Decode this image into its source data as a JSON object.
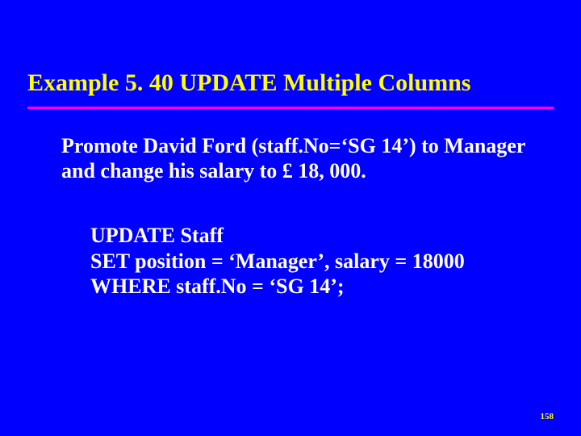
{
  "slide": {
    "title": "Example 5. 40  UPDATE Multiple Columns",
    "description_line1": "Promote David Ford (staff.No=‘SG 14’) to Manager",
    "description_line2": "and change his salary to £ 18, 000.",
    "code_line1": "UPDATE Staff",
    "code_line2": "SET position = ‘Manager’, salary = 18000",
    "code_line3": "WHERE staff.No = ‘SG 14’;",
    "page_number": "158"
  },
  "colors": {
    "background": "#0000ff",
    "title": "#ffff00",
    "rule": "#ff00ff",
    "body": "#ffffff",
    "pagenum": "#ffff00"
  }
}
